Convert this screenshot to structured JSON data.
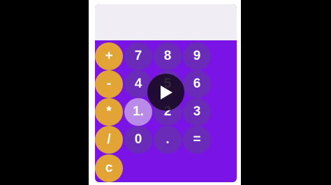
{
  "display": {
    "value": ""
  },
  "keys": {
    "plus": "+",
    "minus": "-",
    "multiply": "*",
    "divide": "/",
    "clear": "c",
    "seven": "7",
    "eight": "8",
    "nine": "9",
    "four": "4",
    "five": "5",
    "six": "6",
    "one": "1.",
    "two": "2",
    "three": "3",
    "zero": "0",
    "dot": ".",
    "equals": "="
  },
  "colors": {
    "background": "#000000",
    "calculator_body": "#7a14e6",
    "display": "#f0eef4",
    "operator_key": "#e2a535",
    "number_key": "#6a2bb8",
    "active_key": "#b98ae8",
    "play_overlay": "#140a1e"
  },
  "overlay": {
    "icon": "play-icon"
  }
}
